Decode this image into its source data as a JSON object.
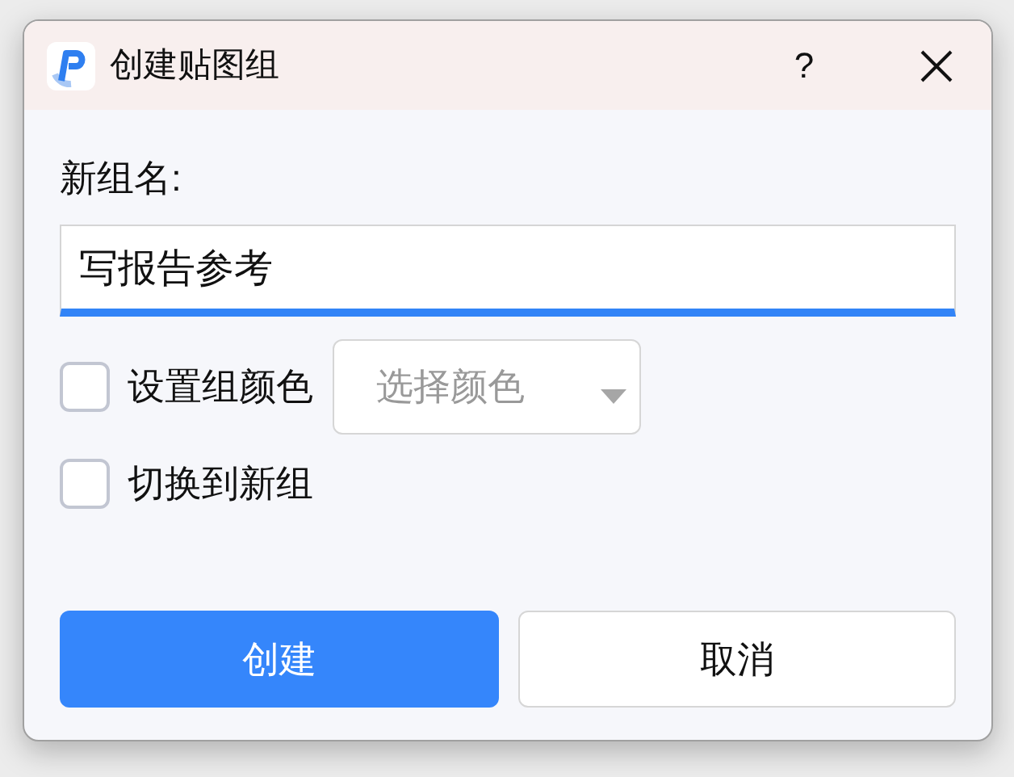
{
  "window": {
    "title": "创建贴图组",
    "help": "?"
  },
  "name_field": {
    "label": "新组名:",
    "value": "写报告参考",
    "focused": true
  },
  "options": [
    {
      "kind": "color",
      "label": "设置组颜色",
      "checked": false,
      "dropdown": {
        "placeholder": "选择颜色"
      }
    },
    {
      "kind": "plain",
      "label": "切换到新组",
      "checked": false
    }
  ],
  "buttons": [
    {
      "label": "创建",
      "primary": true
    },
    {
      "label": "取消",
      "primary": false
    }
  ]
}
